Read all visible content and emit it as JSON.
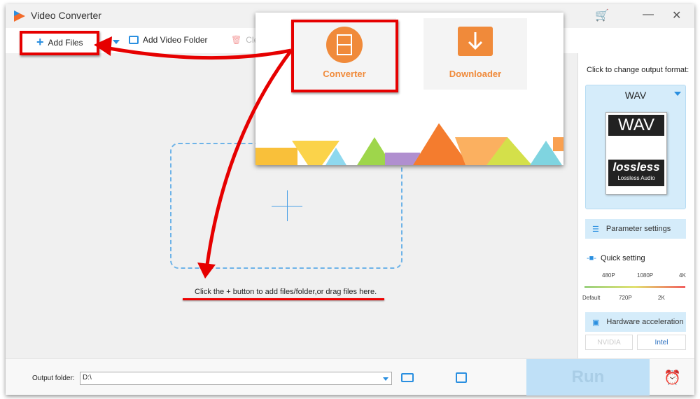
{
  "window": {
    "title": "Video Converter"
  },
  "toolbar": {
    "add_files": "Add Files",
    "add_video_folder": "Add Video Folder",
    "clear": "Cle"
  },
  "main": {
    "hint": "Click the + button to add files/folder,or drag files here."
  },
  "popup": {
    "converter": "Converter",
    "downloader": "Downloader"
  },
  "right_panel": {
    "format_prompt": "Click to change output format:",
    "format": "WAV",
    "format_icon": {
      "top": "WAV",
      "brand": "lossless",
      "sub": "Lossless Audio"
    },
    "parameter_settings": "Parameter settings",
    "quick_setting": "Quick setting",
    "quality_top": [
      "480P",
      "1080P",
      "4K"
    ],
    "quality_bottom": [
      "Default",
      "720P",
      "2K"
    ],
    "hardware_acceleration": "Hardware acceleration",
    "nvidia": "NVIDIA",
    "intel": "Intel"
  },
  "bottom": {
    "output_label": "Output folder:",
    "output_value": "D:\\",
    "run": "Run"
  },
  "colors": {
    "accent": "#2a8fe0",
    "annotation": "#e60000",
    "orange": "#f08a3a"
  }
}
